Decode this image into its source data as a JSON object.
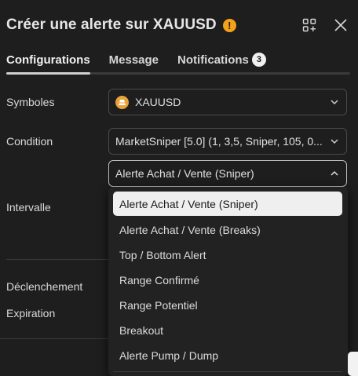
{
  "header": {
    "title": "Créer une alerte sur XAUUSD",
    "warning_glyph": "!",
    "icons": [
      "add-widget-icon",
      "close-icon"
    ]
  },
  "tabs": [
    {
      "label": "Configurations",
      "active": true
    },
    {
      "label": "Message",
      "active": false
    },
    {
      "label": "Notifications",
      "active": false,
      "badge": "3"
    }
  ],
  "form": {
    "symbol_label": "Symboles",
    "symbol_value": "XAUUSD",
    "condition_label": "Condition",
    "condition_value": "MarketSniper [5.0] (1, 3,5, Sniper, 105, 0...",
    "condition_sub_value": "Alerte Achat / Vente (Sniper)",
    "interval_label": "Intervalle",
    "trigger_label": "Déclenchement",
    "expiration_label": "Expiration"
  },
  "dropdown": {
    "options": [
      "Alerte Achat / Vente (Sniper)",
      "Alerte Achat / Vente (Breaks)",
      "Top / Bottom Alert",
      "Range Confirmé",
      "Range Potentiel",
      "Breakout",
      "Alerte Pump / Dump"
    ],
    "selected_index": 0
  },
  "colors": {
    "background": "#1e1e1e",
    "warning": "#f4a218",
    "symbol_icon": "#e8a33a",
    "selected_option_bg": "#efefef"
  }
}
